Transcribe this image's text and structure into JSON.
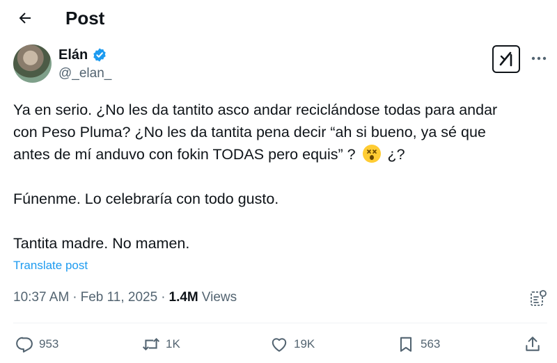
{
  "header": {
    "title": "Post"
  },
  "author": {
    "name": "Elán",
    "handle": "@_elan_",
    "verified": true
  },
  "tweet": {
    "line1": "Ya en serio. ¿No les da tantito asco andar reciclándose todas para andar",
    "line2": "con Peso Pluma? ¿No les da tantita pena decir “ah si bueno, ya sé que",
    "line3a": "antes de mí anduvo con fokin TODAS pero equis” ? ",
    "line3b": " ¿?",
    "line4": "Fúnenme. Lo celebraría con todo gusto.",
    "line5": "Tantita madre. No mamen."
  },
  "translate_label": "Translate post",
  "meta": {
    "time": "10:37 AM",
    "sep1": "·",
    "date": "Feb 11, 2025",
    "sep2": "·",
    "views_count": "1.4M",
    "views_label": "Views"
  },
  "actions": {
    "replies": "953",
    "reposts": "1K",
    "likes": "19K",
    "bookmarks": "563"
  },
  "colors": {
    "accent": "#1d9bf0",
    "secondary": "#536471",
    "text": "#0f1419"
  }
}
